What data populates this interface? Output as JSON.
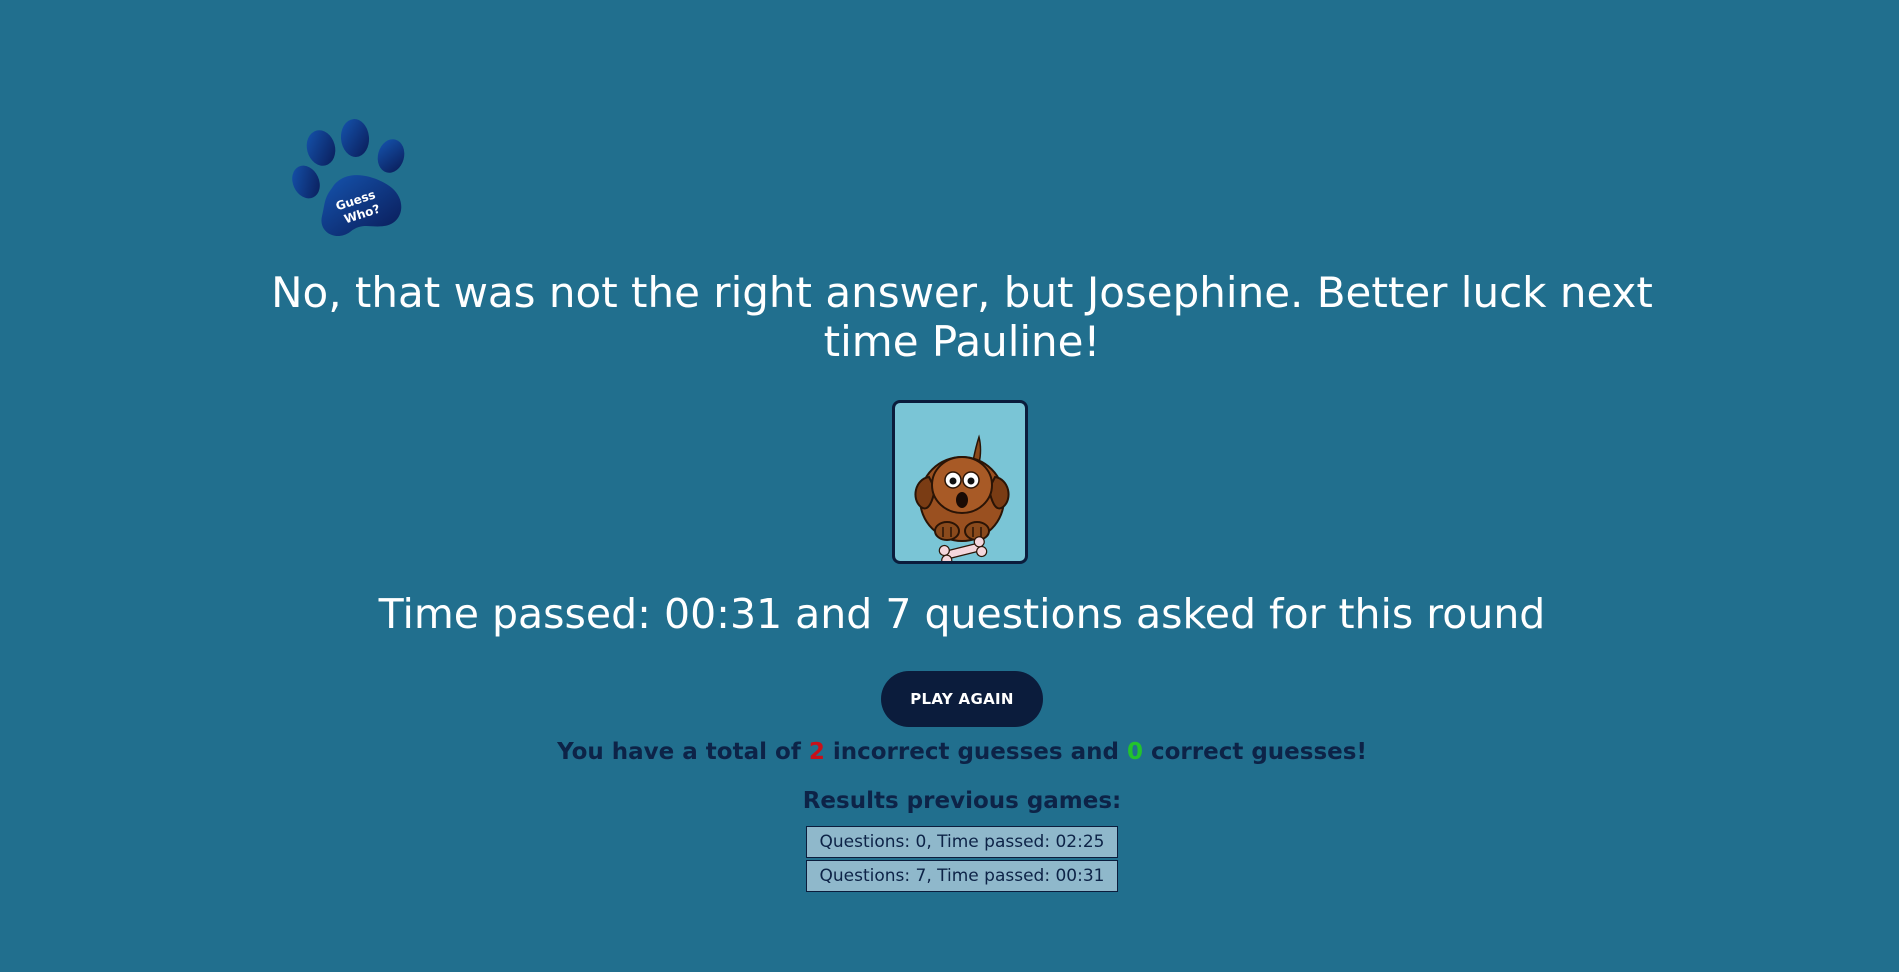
{
  "logo": {
    "text_line1": "Guess",
    "text_line2": "Who?"
  },
  "result_message": "No, that was not the right answer, but Josephine. Better luck next time Pauline!",
  "card": {
    "subject": "dog-cartoon-with-bone"
  },
  "round_summary": "Time passed: 00:31 and 7 questions asked for this round",
  "play_again_label": "PLAY AGAIN",
  "totals": {
    "prefix": "You have a total of ",
    "incorrect_count": "2",
    "middle": " incorrect guesses and ",
    "correct_count": "0",
    "suffix": " correct guesses!"
  },
  "results": {
    "title": "Results previous games:",
    "entries": [
      "Questions: 0, Time passed: 02:25",
      "Questions: 7, Time passed: 00:31"
    ]
  },
  "colors": {
    "background": "#216f8e",
    "button": "#0b1c3c",
    "incorrect": "#c8101a",
    "correct": "#22c32c",
    "card_background": "#7ac5d6"
  }
}
